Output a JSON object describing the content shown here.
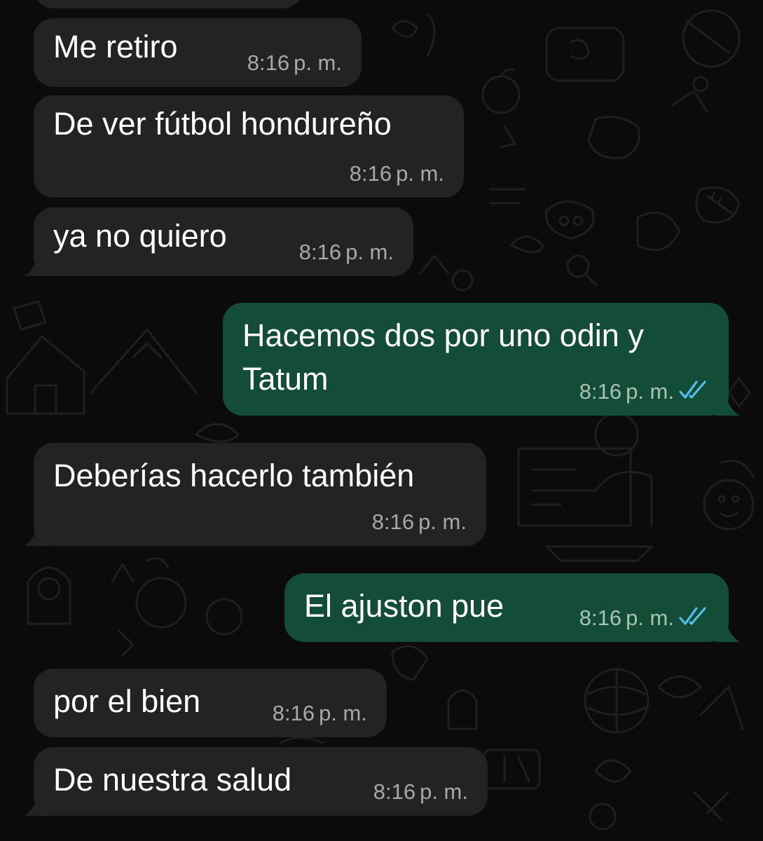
{
  "messages": [
    {
      "direction": "incoming",
      "text": "",
      "time": "",
      "period": ""
    },
    {
      "direction": "incoming",
      "text": "Me retiro",
      "time": "8:16",
      "period": "p. m."
    },
    {
      "direction": "incoming",
      "text": "De ver fútbol hondureño",
      "time": "8:16",
      "period": "p. m."
    },
    {
      "direction": "incoming",
      "text": "ya no quiero",
      "time": "8:16",
      "period": "p. m."
    },
    {
      "direction": "outgoing",
      "text_lines": [
        "Hacemos dos por uno odin y",
        "Tatum"
      ],
      "time": "8:16",
      "period": "p. m.",
      "status": "read"
    },
    {
      "direction": "incoming",
      "text": "Deberías hacerlo también",
      "time": "8:16",
      "period": "p. m."
    },
    {
      "direction": "outgoing",
      "text": "El ajuston pue",
      "time": "8:16",
      "period": "p. m.",
      "status": "read"
    },
    {
      "direction": "incoming",
      "text": "por el bien",
      "time": "8:16",
      "period": "p. m."
    },
    {
      "direction": "incoming",
      "text": "De nuestra salud",
      "time": "8:16",
      "period": "p. m."
    }
  ],
  "colors": {
    "background": "#0b0b0b",
    "incoming_bubble": "#232323",
    "outgoing_bubble": "#144d37",
    "timestamp": "#a8a8a8",
    "read_check": "#53bdeb"
  },
  "icons": {
    "read_receipt": "double-check-icon",
    "wallpaper": "doodle-pattern"
  }
}
